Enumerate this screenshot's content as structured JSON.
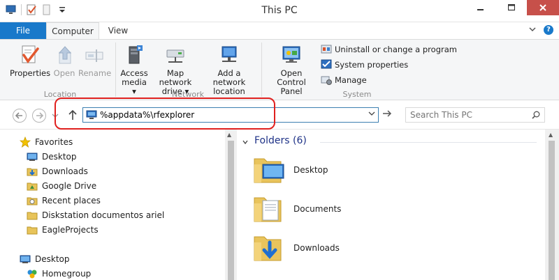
{
  "window": {
    "title": "This PC"
  },
  "tabs": {
    "file": "File",
    "computer": "Computer",
    "view": "View"
  },
  "ribbon": {
    "location": {
      "label": "Location",
      "buttons": [
        {
          "label": "Properties"
        },
        {
          "label": "Open"
        },
        {
          "label": "Rename"
        }
      ]
    },
    "network": {
      "label": "Network",
      "buttons": [
        {
          "line1": "Access",
          "line2": "media ▾"
        },
        {
          "line1": "Map network",
          "line2": "drive ▾"
        },
        {
          "line1": "Add a network",
          "line2": "location"
        }
      ]
    },
    "system": {
      "label": "System",
      "open_control_panel": {
        "line1": "Open Control",
        "line2": "Panel"
      },
      "uninstall": "Uninstall or change a program",
      "system_properties": "System properties",
      "manage": "Manage"
    }
  },
  "address": {
    "value": "%appdata%\\rfexplorer",
    "search_placeholder": "Search This PC"
  },
  "nav": {
    "favorites": "Favorites",
    "items": [
      {
        "label": "Desktop"
      },
      {
        "label": "Downloads"
      },
      {
        "label": "Google Drive"
      },
      {
        "label": "Recent places"
      },
      {
        "label": "Diskstation documentos ariel"
      },
      {
        "label": "EagleProjects"
      }
    ],
    "desktop": "Desktop",
    "homegroup": "Homegroup"
  },
  "content": {
    "group": "Folders (6)",
    "folders": [
      {
        "label": "Desktop"
      },
      {
        "label": "Documents"
      },
      {
        "label": "Downloads"
      }
    ]
  },
  "colors": {
    "file_tab": "#1979ca",
    "close_button": "#c7504a",
    "highlight": "#e0201e",
    "group_header": "#1e3287"
  }
}
